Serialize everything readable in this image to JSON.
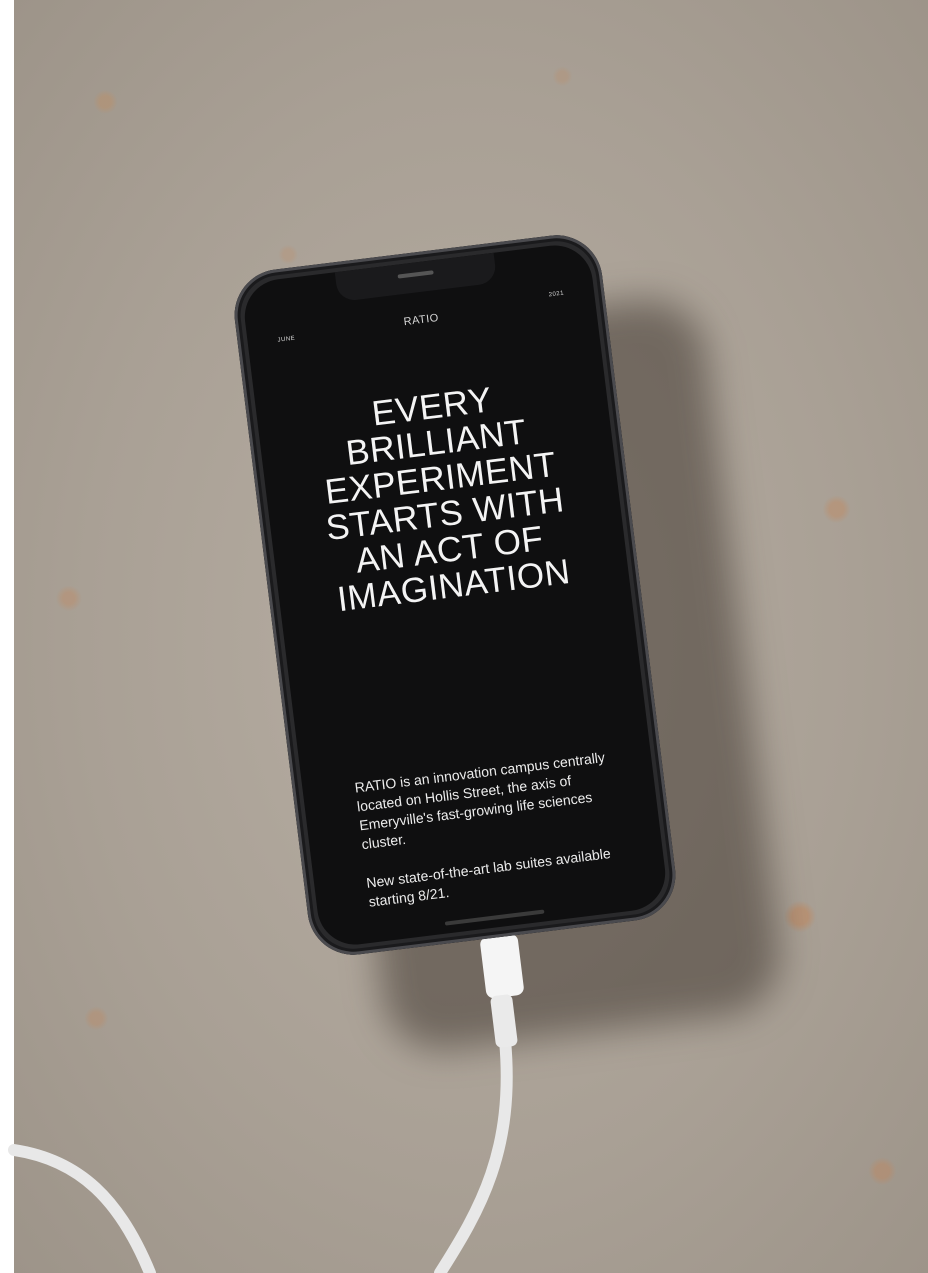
{
  "status_bar": {
    "left": "JUNE",
    "center": "RATIO",
    "right": "2021"
  },
  "headline": {
    "lines": [
      "EVERY",
      "BRILLIANT",
      "EXPERIMENT",
      "STARTS WITH",
      "AN ACT OF",
      "IMAGINATION"
    ]
  },
  "body": {
    "paragraph_1": "RATIO is an innovation campus centrally located on Hollis Street, the axis of Emeryville's fast-growing life sciences cluster.",
    "paragraph_2": "New state-of-the-art lab suites available starting 8/21."
  },
  "colors": {
    "screen_bg": "#0f0f10",
    "text": "#f4f4f4",
    "ground": "#a9a095"
  }
}
